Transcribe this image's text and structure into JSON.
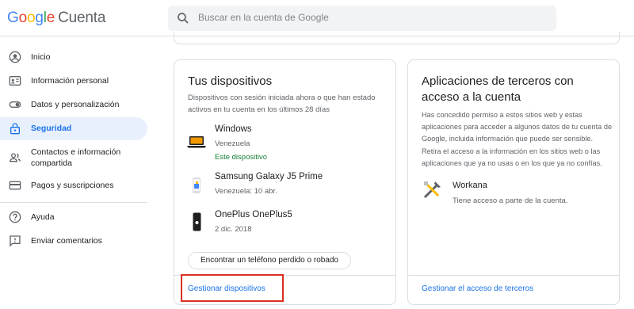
{
  "header": {
    "logo_letters": [
      "G",
      "o",
      "o",
      "g",
      "l",
      "e"
    ],
    "product": "Cuenta",
    "search_placeholder": "Buscar en la cuenta de Google"
  },
  "sidebar": {
    "items": [
      {
        "label": "Inicio",
        "icon": "account-circle-icon"
      },
      {
        "label": "Información personal",
        "icon": "id-card-icon"
      },
      {
        "label": "Datos y personalización",
        "icon": "toggle-icon"
      },
      {
        "label": "Seguridad",
        "icon": "lock-icon",
        "active": true
      },
      {
        "label": "Contactos e información compartida",
        "icon": "people-icon"
      },
      {
        "label": "Pagos y suscripciones",
        "icon": "credit-card-icon"
      },
      {
        "label": "Ayuda",
        "icon": "help-icon"
      },
      {
        "label": "Enviar comentarios",
        "icon": "feedback-icon"
      }
    ]
  },
  "devices_card": {
    "title": "Tus dispositivos",
    "description_line1": "Dispositivos con sesión iniciada ahora o que han estado",
    "description_line2": "activos en tu cuenta en los últimos 28 días",
    "devices": [
      {
        "name": "Windows",
        "detail": "Venezuela",
        "status": "Este dispositivo",
        "icon": "laptop-icon"
      },
      {
        "name": "Samsung Galaxy J5 Prime",
        "detail": "Venezuela: 10 abr.",
        "icon": "android-phone-icon"
      },
      {
        "name": "OnePlus OnePlus5",
        "detail": "2 dic. 2018",
        "icon": "phone-icon"
      }
    ],
    "find_button": "Encontrar un teléfono perdido o robado",
    "manage_link": "Gestionar dispositivos"
  },
  "third_party_card": {
    "title_line1": "Aplicaciones de terceros con",
    "title_line2": "acceso a la cuenta",
    "description_lines": [
      "Has concedido permiso a estos sitios web y estas",
      "aplicaciones para acceder a algunos datos de tu cuenta de",
      "Google, incluida información que puede ser sensible.",
      "Retira el acceso a la información en los sitios web o las",
      "aplicaciones que ya no usas o en los que ya no confías."
    ],
    "app": {
      "name": "Workana",
      "access": "Tiene acceso a parte de la cuenta.",
      "icon": "workana-icon"
    },
    "manage_link": "Gestionar el acceso de terceros"
  },
  "colors": {
    "accent": "#1a73e8",
    "active_bg": "#e8f0fe",
    "highlight": "#d93025",
    "green": "#188038"
  }
}
